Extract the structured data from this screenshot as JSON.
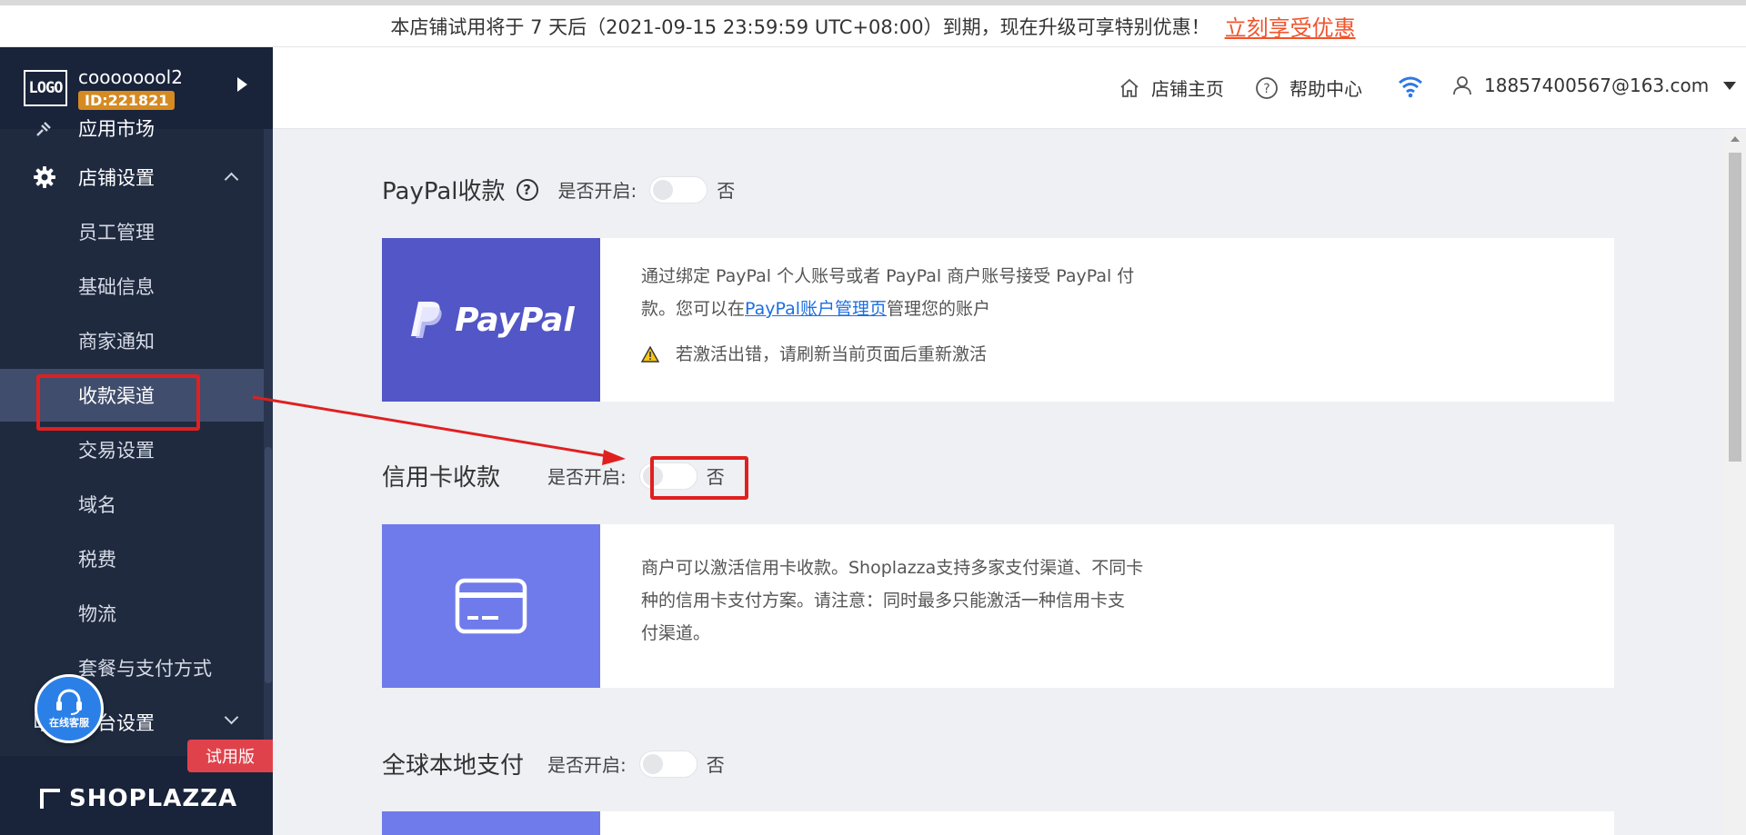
{
  "banner": {
    "message": "本店铺试用将于 7 天后（2021-09-15 23:59:59 UTC+08:00）到期，现在升级可享特别优惠！",
    "upgrade_link": "立刻享受优惠"
  },
  "sidebar": {
    "logo_text": "LOGO",
    "store_name": "coooooool2",
    "store_id": "ID:221821",
    "items": [
      {
        "label": "应用市场"
      },
      {
        "label": "店铺设置"
      },
      {
        "label": "员工管理"
      },
      {
        "label": "基础信息"
      },
      {
        "label": "商家通知"
      },
      {
        "label": "收款渠道"
      },
      {
        "label": "交易设置"
      },
      {
        "label": "域名"
      },
      {
        "label": "税费"
      },
      {
        "label": "物流"
      },
      {
        "label": "套餐与支付方式"
      },
      {
        "label": "平台设置"
      }
    ],
    "trial_badge": "试用版",
    "brand": "SHOPLAZZA",
    "customer_service": "在线客服"
  },
  "topbar": {
    "store_home": "店铺主页",
    "help_center": "帮助中心",
    "account": "18857400567@163.com"
  },
  "sections": {
    "paypal": {
      "title": "PayPal收款",
      "help": "?",
      "enable_label": "是否开启:",
      "state": "否",
      "logo_text": "PayPal",
      "desc_line1": "通过绑定 PayPal 个人账号或者 PayPal 商户账号接受 PayPal 付",
      "desc_line2_prefix": "款。您可以在",
      "desc_link": "PayPal账户管理页",
      "desc_line2_suffix": "管理您的账户",
      "warning": "若激活出错，请刷新当前页面后重新激活"
    },
    "credit": {
      "title": "信用卡收款",
      "enable_label": "是否开启:",
      "state": "否",
      "desc_line1": "商户可以激活信用卡收款。Shoplazza支持多家支付渠道、不同卡",
      "desc_line2": "种的信用卡支付方案。请注意：同时最多只能激活一种信用卡支",
      "desc_line3": "付渠道。"
    },
    "global": {
      "title": "全球本地支付",
      "enable_label": "是否开启:",
      "state": "否"
    }
  },
  "colors": {
    "sidebar_bg": "#1f2a3f",
    "active_item": "#404d6c",
    "paypal_card": "#5356c6",
    "credit_card": "#6f7bea",
    "accent_orange": "#f0542d",
    "link_blue": "#1d6fe0",
    "annotation_red": "#e02020"
  }
}
